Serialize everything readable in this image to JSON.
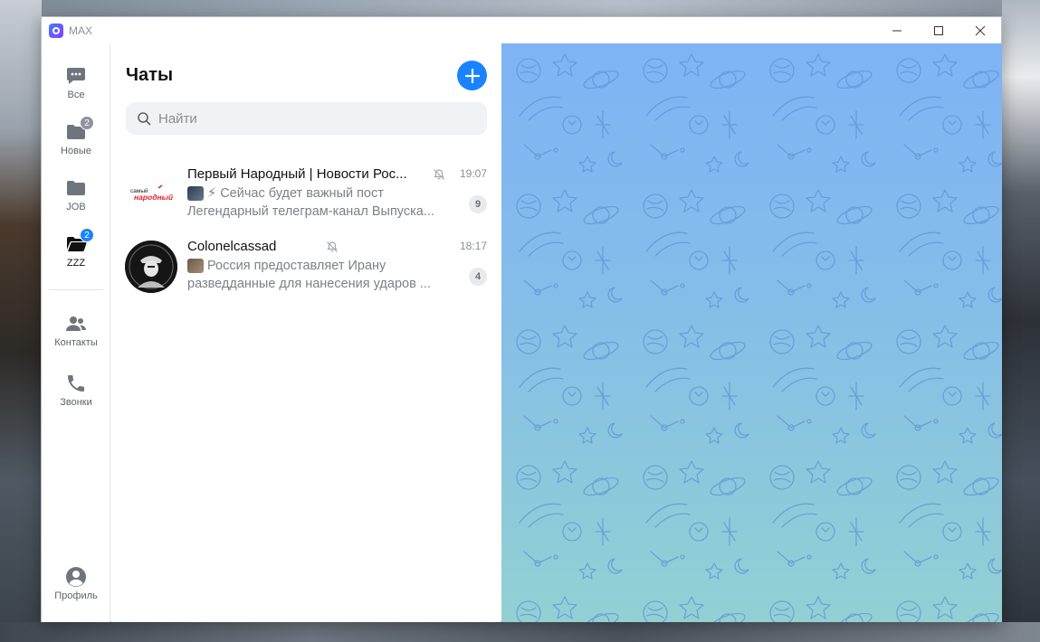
{
  "window": {
    "title": "MAX",
    "controls": {
      "minimize": "—",
      "maximize": "☐",
      "close": "✕"
    }
  },
  "rail": {
    "items": [
      {
        "id": "all",
        "label": "Все",
        "icon": "chat-bubble-icon",
        "badge": null
      },
      {
        "id": "new",
        "label": "Новые",
        "icon": "folder-icon",
        "badge": "2"
      },
      {
        "id": "job",
        "label": "JOB",
        "icon": "folder-icon",
        "badge": null
      },
      {
        "id": "zzz",
        "label": "ZZZ",
        "icon": "folder-open-icon",
        "badge": "2"
      },
      {
        "id": "contacts",
        "label": "Контакты",
        "icon": "users-icon",
        "badge": null
      },
      {
        "id": "calls",
        "label": "Звонки",
        "icon": "phone-icon",
        "badge": null
      },
      {
        "id": "profile",
        "label": "Профиль",
        "icon": "profile-icon",
        "badge": null
      }
    ],
    "colors": {
      "icon": "#6f757c",
      "badge_gray": "#8e949b",
      "badge_blue": "#1a83ff"
    }
  },
  "list": {
    "title": "Чаты",
    "search": {
      "placeholder": "Найти",
      "value": ""
    },
    "chats": [
      {
        "name": "Первый Народный | Новости Рос...",
        "muted": true,
        "time": "19:07",
        "preview_line1": "⚡ Сейчас будет важный пост",
        "preview_line2": "Легендарный телеграм-канал Выпуска...",
        "unread": "9"
      },
      {
        "name": "Colonelcassad",
        "muted": true,
        "time": "18:17",
        "preview_line1": "Россия предоставляет Ирану",
        "preview_line2": "разведданные для нанесения ударов ...",
        "unread": "4"
      }
    ],
    "avatar_text": {
      "top": "самый",
      "bottom": "народный"
    }
  },
  "colors": {
    "accent": "#1a83ff",
    "chat_bg_top": "#7fb3f5",
    "chat_bg_bottom": "#93d0d4",
    "pattern_stroke": "#5f93d6"
  }
}
